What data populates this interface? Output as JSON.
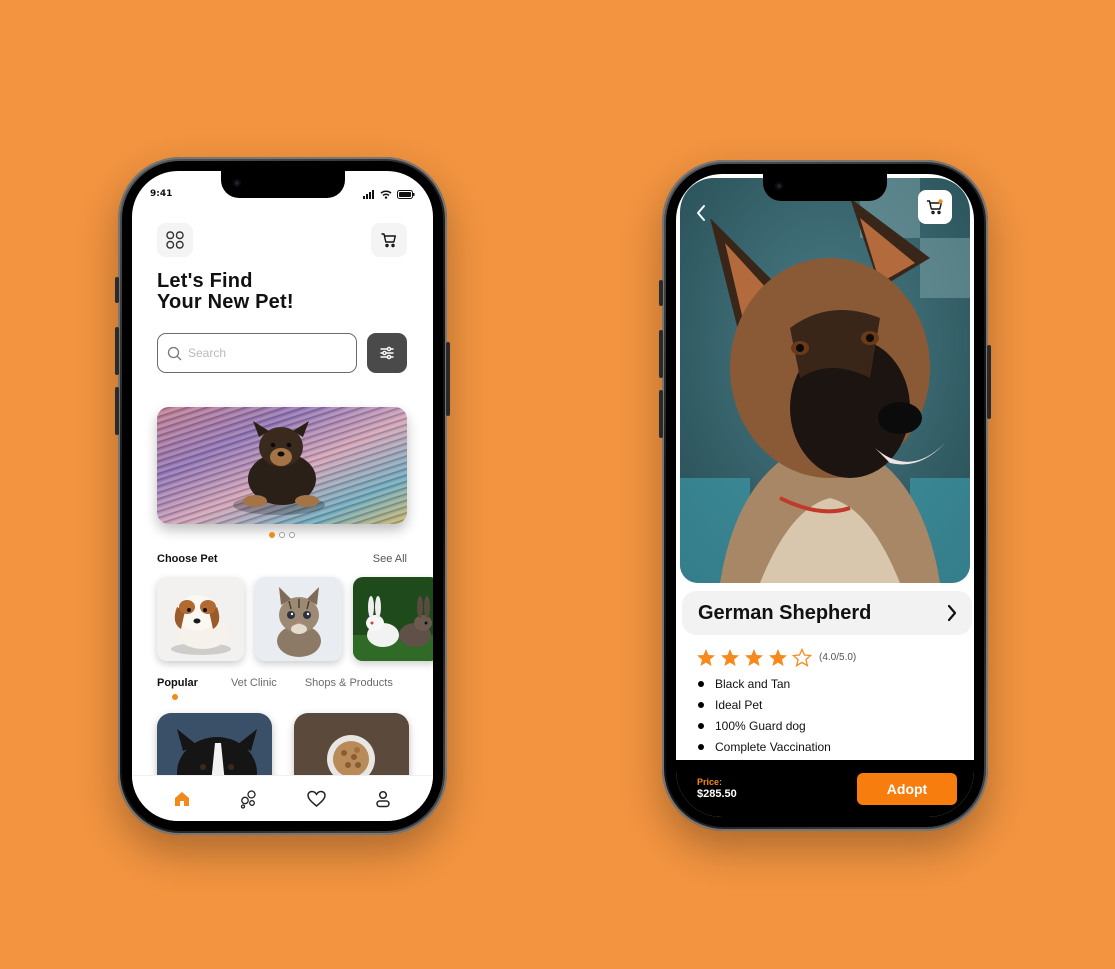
{
  "theme": {
    "background": "#F29440",
    "accent": "#F08A1C",
    "filter_button": "#4A4A4A",
    "adopt_button": "#F77D0E"
  },
  "home_screen": {
    "status_time": "9:41",
    "menu_icon": "grid-icon",
    "cart_icon": "cart-icon",
    "headline_line1": "Let's Find",
    "headline_line2": "Your New Pet!",
    "search_placeholder": "Search",
    "filter_icon": "sliders-icon",
    "banner_alt": "Yorkshire puppy on colorful rug",
    "carousel": {
      "count": 3,
      "active": 0
    },
    "choose_pet_title": "Choose Pet",
    "see_all": "See All",
    "pets": [
      {
        "name": "puppy"
      },
      {
        "name": "kitten"
      },
      {
        "name": "rabbits"
      }
    ],
    "tabs": [
      {
        "label": "Popular",
        "active": true
      },
      {
        "label": "Vet Clinic",
        "active": false
      },
      {
        "label": "Shops & Products",
        "active": false
      }
    ],
    "popular_items": [
      {
        "name": "border collie"
      },
      {
        "name": "pet food bowl"
      }
    ],
    "nav": [
      {
        "icon": "home-icon",
        "active": true
      },
      {
        "icon": "paw-icon",
        "active": false
      },
      {
        "icon": "heart-icon",
        "active": false
      },
      {
        "icon": "profile-icon",
        "active": false
      }
    ]
  },
  "detail_screen": {
    "back_icon": "chevron-left-icon",
    "cart_icon": "cart-icon",
    "pet_name": "German Shepherd",
    "rating": {
      "value": 4.0,
      "max": 5.0,
      "text": "(4.0/5.0)"
    },
    "features": [
      "Black and Tan",
      "Ideal Pet",
      "100% Guard dog",
      "Complete Vaccination"
    ],
    "price_label": "Price:",
    "price_value": "$285.50",
    "adopt_label": "Adopt"
  }
}
